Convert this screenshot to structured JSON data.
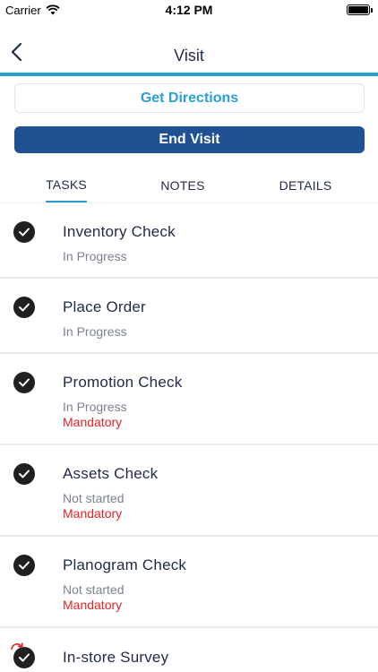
{
  "status_bar": {
    "carrier": "Carrier",
    "time": "4:12 PM",
    "icons": [
      "wifi-icon",
      "battery-icon"
    ]
  },
  "nav": {
    "title": "Visit",
    "back_icon": "chevron-left-icon",
    "accent_color": "#27a0cc"
  },
  "actions": {
    "directions_label": "Get Directions",
    "end_visit_label": "End Visit",
    "end_visit_color": "#1f5193",
    "directions_color": "#2a9fd8"
  },
  "tabs": [
    {
      "label": "TASKS",
      "active": true
    },
    {
      "label": "NOTES",
      "active": false
    },
    {
      "label": "DETAILS",
      "active": false
    }
  ],
  "tasks": [
    {
      "title": "Inventory Check",
      "status": "In Progress",
      "mandatory": "",
      "icon": "check-circle-icon"
    },
    {
      "title": "Place Order",
      "status": "In Progress",
      "mandatory": "",
      "icon": "check-circle-icon"
    },
    {
      "title": "Promotion Check",
      "status": "In Progress",
      "mandatory": "Mandatory",
      "icon": "check-circle-icon"
    },
    {
      "title": "Assets Check",
      "status": "Not started",
      "mandatory": "Mandatory",
      "icon": "check-circle-icon"
    },
    {
      "title": "Planogram Check",
      "status": "Not started",
      "mandatory": "Mandatory",
      "icon": "check-circle-icon"
    },
    {
      "title": "In-store Survey",
      "status": "",
      "mandatory": "",
      "icon": "check-circle-icon",
      "overlay_icon": "sync-icon"
    }
  ],
  "colors": {
    "mandatory": "#e02424",
    "status_text": "#7a8290",
    "title_text": "#1e2b45"
  }
}
